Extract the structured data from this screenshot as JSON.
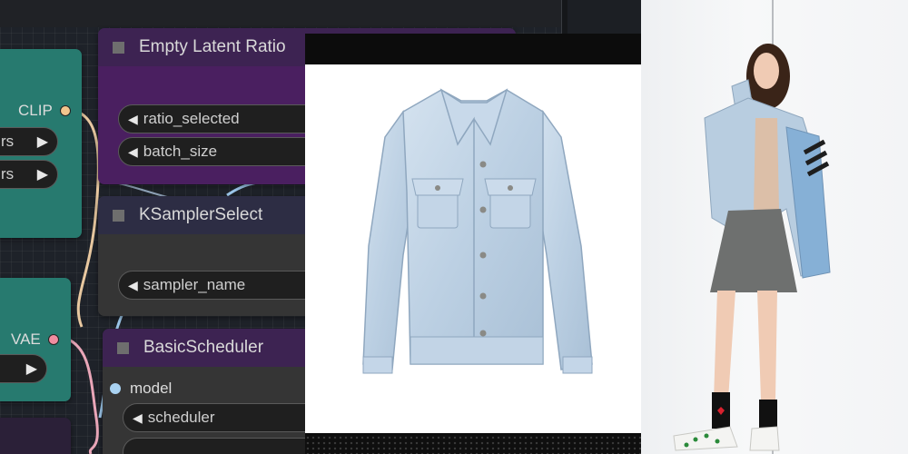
{
  "nodes": {
    "left_top": {
      "output": "CLIP",
      "widgets": [
        "rs",
        "rs"
      ]
    },
    "left_mid": {
      "output": "VAE",
      "widgets": [
        ""
      ]
    },
    "empty_latent": {
      "title": "Empty Latent Ratio",
      "widgets": [
        "ratio_selected",
        "batch_size"
      ]
    },
    "ksampler_select": {
      "title": "KSamplerSelect",
      "widgets": [
        "sampler_name"
      ]
    },
    "basic_scheduler": {
      "title": "BasicScheduler",
      "input": "model",
      "widgets": [
        "scheduler"
      ]
    }
  },
  "glyphs": {
    "left": "◀",
    "right": "▶"
  },
  "colors": {
    "canvas": "#1e2229",
    "teal_node": "#277a6f",
    "purple_node": "#4a1f60",
    "clip_pin": "#f2c58d",
    "vae_pin": "#f08da0",
    "model_pin": "#a9d2f2",
    "denim": "#bfd3e6"
  },
  "images": {
    "jacket": "light-wash-denim-jacket-product-photo",
    "model": "woman-wearing-denim-jacket-and-gray-skirt"
  }
}
